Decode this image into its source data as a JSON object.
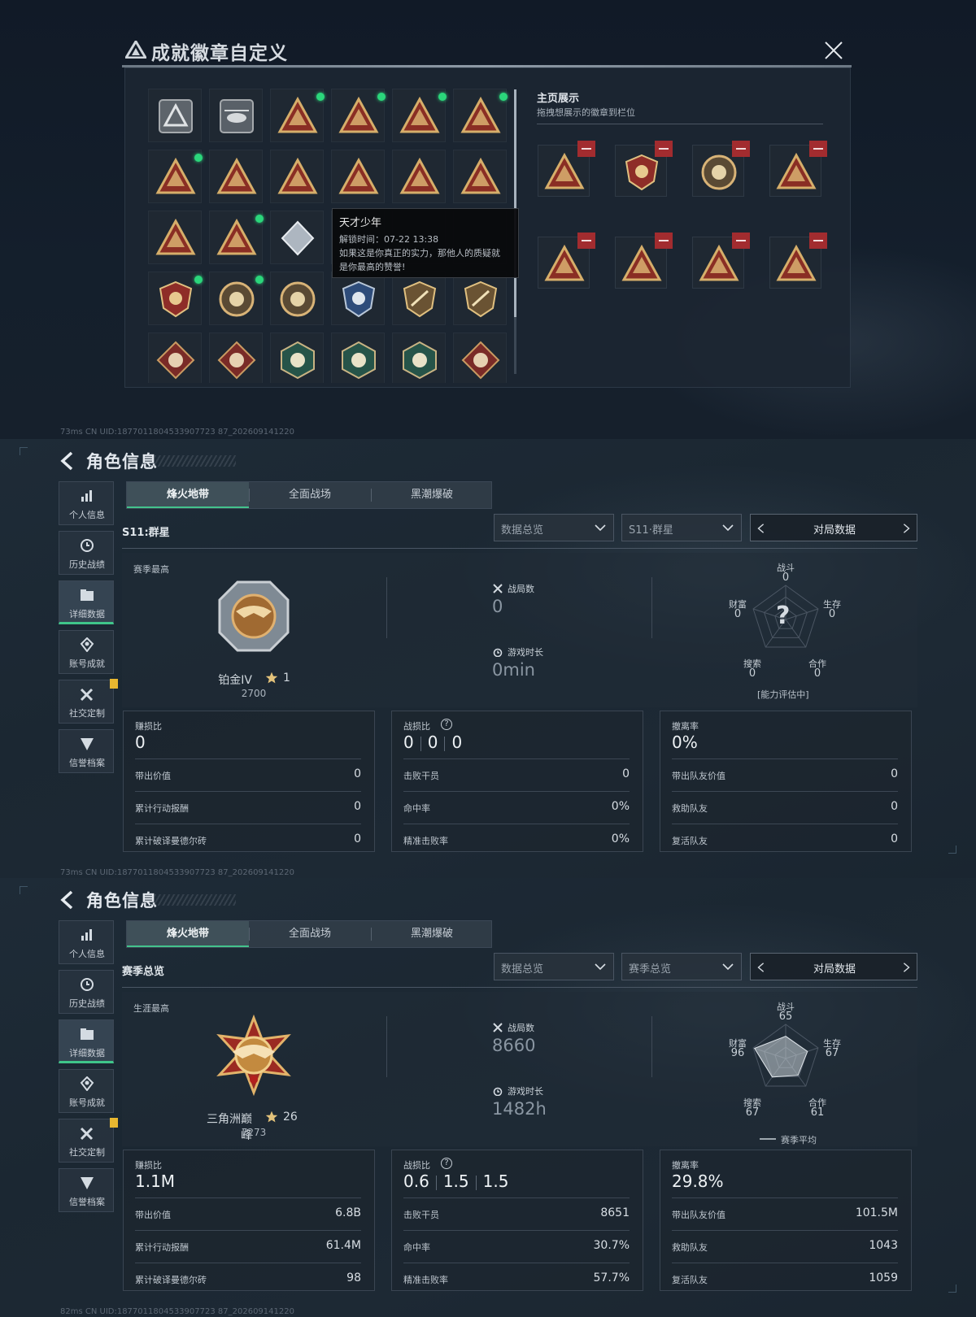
{
  "medal_modal": {
    "title": "成就徽章自定义",
    "tooltip": {
      "name": "天才少年",
      "unlock": "解锁时间：07-22 13:38",
      "desc_line1": "如果这是你真正的实力，那他人的质疑就",
      "desc_line2": "是你最高的赞誉!"
    },
    "showcase_title": "主页展示",
    "showcase_subtitle": "拖拽想展示的徽章到栏位",
    "status_bar": "73ms   CN UID:1877011804533907723 87_202609141220"
  },
  "colors": {
    "accent_green": "#2bd67b",
    "remove_red": "#a22c2f",
    "gold": "#c9a062",
    "badge_yellow": "#e8b730"
  },
  "role1": {
    "title": "角色信息",
    "nav": [
      "个人信息",
      "历史战绩",
      "详细数据",
      "账号成就",
      "社交定制",
      "信誉档案"
    ],
    "tabs": [
      "烽火地带",
      "全面战场",
      "黑潮爆破"
    ],
    "season_label": "S11:群星",
    "dropdown1": "数据总览",
    "dropdown2": "S11·群星",
    "pager": "对局数据",
    "best_label": "赛季最高",
    "rank_name": "铂金IV",
    "rank_stars": "1",
    "rank_score": "2700",
    "matches_label": "战局数",
    "matches_value": "0",
    "time_label": "游戏时长",
    "time_value": "0min",
    "radar": {
      "labels": [
        "战斗",
        "生存",
        "合作",
        "搜索",
        "财富"
      ],
      "values": [
        "0",
        "0",
        "0",
        "0",
        "0"
      ],
      "footer": "[能力评估中]",
      "center": "?"
    },
    "card1": {
      "head": "赚损比",
      "big": "0",
      "rows": [
        [
          "带出价值",
          "0"
        ],
        [
          "累计行动报酬",
          "0"
        ],
        [
          "累计破译曼德尔砖",
          "0"
        ]
      ]
    },
    "card2": {
      "head": "战损比",
      "kd": [
        "0",
        "0",
        "0"
      ],
      "rows": [
        [
          "击败干员",
          "0"
        ],
        [
          "命中率",
          "0%"
        ],
        [
          "精准击败率",
          "0%"
        ]
      ]
    },
    "card3": {
      "head": "撤离率",
      "big": "0%",
      "rows": [
        [
          "带出队友价值",
          "0"
        ],
        [
          "救助队友",
          "0"
        ],
        [
          "复活队友",
          "0"
        ]
      ]
    },
    "status_bar": "73ms   CN UID:1877011804533907723 87_202609141220"
  },
  "role2": {
    "title": "角色信息",
    "nav": [
      "个人信息",
      "历史战绩",
      "详细数据",
      "账号成就",
      "社交定制",
      "信誉档案"
    ],
    "tabs": [
      "烽火地带",
      "全面战场",
      "黑潮爆破"
    ],
    "season_label": "赛季总览",
    "dropdown1": "数据总览",
    "dropdown2": "赛季总览",
    "pager": "对局数据",
    "best_label": "生涯最高",
    "rank_name": "三角洲巅峰",
    "rank_stars": "26",
    "rank_score": "7273",
    "matches_label": "战局数",
    "matches_value": "8660",
    "time_label": "游戏时长",
    "time_value": "1482h",
    "radar": {
      "labels": [
        "战斗",
        "生存",
        "合作",
        "搜索",
        "财富"
      ],
      "values": [
        "65",
        "67",
        "61",
        "67",
        "96"
      ],
      "footer": "赛季平均",
      "scores": [
        65,
        67,
        61,
        67,
        96
      ]
    },
    "card1": {
      "head": "赚损比",
      "big": "1.1M",
      "rows": [
        [
          "带出价值",
          "6.8B"
        ],
        [
          "累计行动报酬",
          "61.4M"
        ],
        [
          "累计破译曼德尔砖",
          "98"
        ]
      ]
    },
    "card2": {
      "head": "战损比",
      "kd": [
        "0.6",
        "1.5",
        "1.5"
      ],
      "rows": [
        [
          "击败干员",
          "8651"
        ],
        [
          "命中率",
          "30.7%"
        ],
        [
          "精准击败率",
          "57.7%"
        ]
      ]
    },
    "card3": {
      "head": "撤离率",
      "big": "29.8%",
      "rows": [
        [
          "带出队友价值",
          "101.5M"
        ],
        [
          "救助队友",
          "1043"
        ],
        [
          "复活队友",
          "1059"
        ]
      ]
    },
    "status_bar": "82ms   CN UID:1877011804533907723 87_202609141220"
  }
}
